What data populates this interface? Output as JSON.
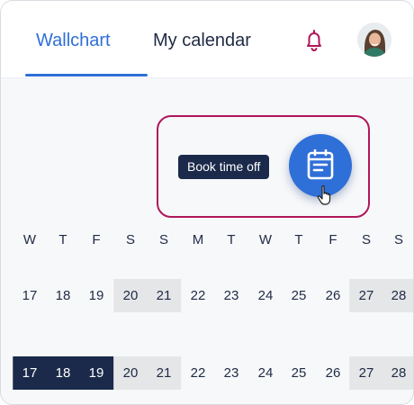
{
  "tabs": [
    {
      "label": "Wallchart",
      "active": true
    },
    {
      "label": "My calendar",
      "active": false
    }
  ],
  "header": {
    "bell_icon": "bell-icon",
    "avatar_icon": "user-avatar",
    "accent_color": "#2f6fd8",
    "bell_color": "#b0165a"
  },
  "booking": {
    "tooltip": "Book time off",
    "button_icon": "calendar-icon",
    "highlight_color": "#b0165a"
  },
  "calendar": {
    "weekdays": [
      "W",
      "T",
      "F",
      "S",
      "S",
      "M",
      "T",
      "W",
      "T",
      "F",
      "S",
      "S"
    ],
    "row1": [
      "17",
      "18",
      "19",
      "20",
      "21",
      "22",
      "23",
      "24",
      "25",
      "26",
      "27",
      "28"
    ],
    "row2": [
      "17",
      "18",
      "19",
      "20",
      "21",
      "22",
      "23",
      "24",
      "25",
      "26",
      "27",
      "28"
    ]
  }
}
